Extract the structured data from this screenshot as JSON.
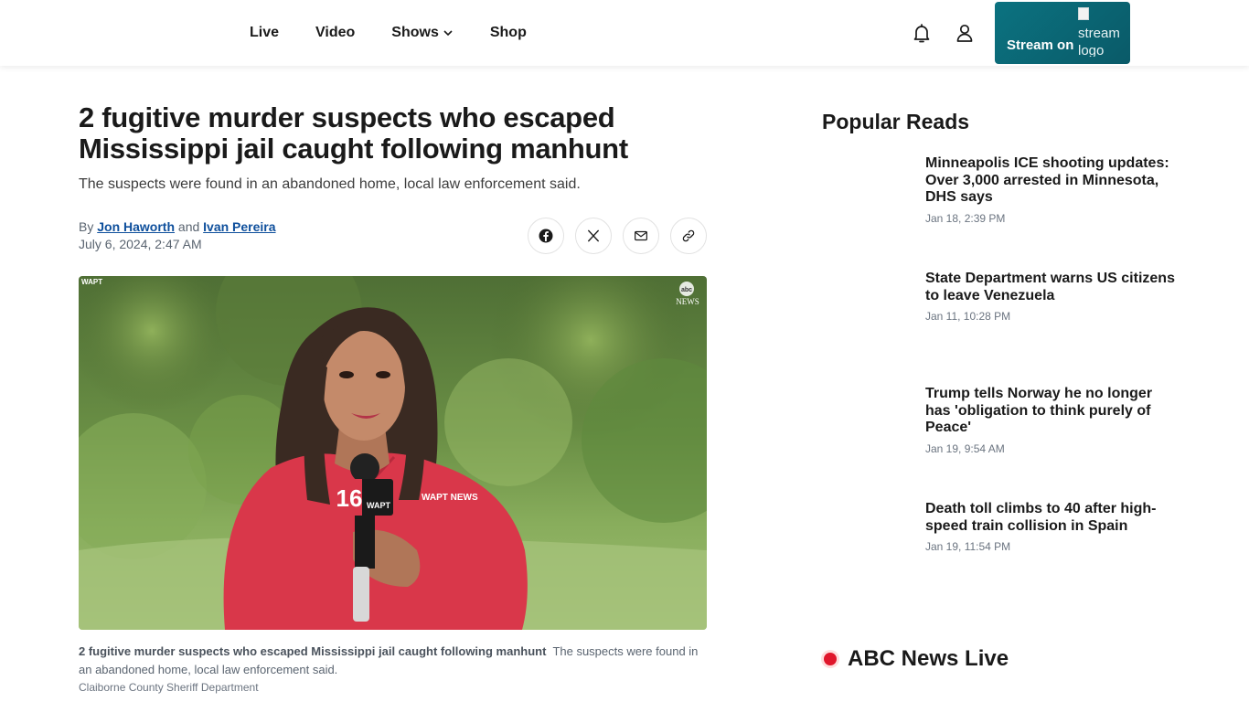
{
  "nav": {
    "items": [
      {
        "label": "Live"
      },
      {
        "label": "Video"
      },
      {
        "label": "Shows"
      },
      {
        "label": "Shop"
      }
    ]
  },
  "header": {
    "stream_label": "Stream on",
    "stream_logo_alt": "stream logo",
    "icons": [
      "bell-icon",
      "user-icon"
    ]
  },
  "article": {
    "headline": "2 fugitive murder suspects who escaped Mississippi jail caught following manhunt",
    "dek": "The suspects were found in an abandoned home, local law enforcement said.",
    "by": "By",
    "author1": "Jon Haworth",
    "and": "and",
    "author2": "Ivan Pereira",
    "date": "July 6, 2024, 2:47 AM",
    "share_icons": [
      "facebook-icon",
      "x-icon",
      "mail-icon",
      "link-icon"
    ],
    "photo": {
      "watermark_left": "WAPT",
      "watermark_right_top": "abc",
      "watermark_right_bottom": "NEWS",
      "mic_number": "16",
      "mic_label": "WAPT",
      "shirt_label": "WAPT NEWS"
    },
    "caption_bold": "2 fugitive murder suspects who escaped Mississippi jail caught following manhunt",
    "caption_text": "The suspects were found in an abandoned home, local law enforcement said.",
    "credit": "Claiborne County Sheriff Department"
  },
  "sidebar": {
    "title": "Popular Reads",
    "items": [
      {
        "title": "Minneapolis ICE shooting updates: Over 3,000 arrested in Minnesota, DHS says",
        "date": "Jan 18, 2:39 PM"
      },
      {
        "title": "State Department warns US citizens to leave Venezuela",
        "date": "Jan 11, 10:28 PM"
      },
      {
        "title": "Trump tells Norway he no longer has 'obligation to think purely of Peace'",
        "date": "Jan 19, 9:54 AM"
      },
      {
        "title": "Death toll climbs to 40 after high-speed train collision in Spain",
        "date": "Jan 19, 11:54 PM"
      }
    ],
    "live_label": "ABC News Live"
  },
  "colors": {
    "accent_link": "#0e4f9c",
    "stream_button": "#0b7280",
    "live_dot": "#e0162b"
  }
}
